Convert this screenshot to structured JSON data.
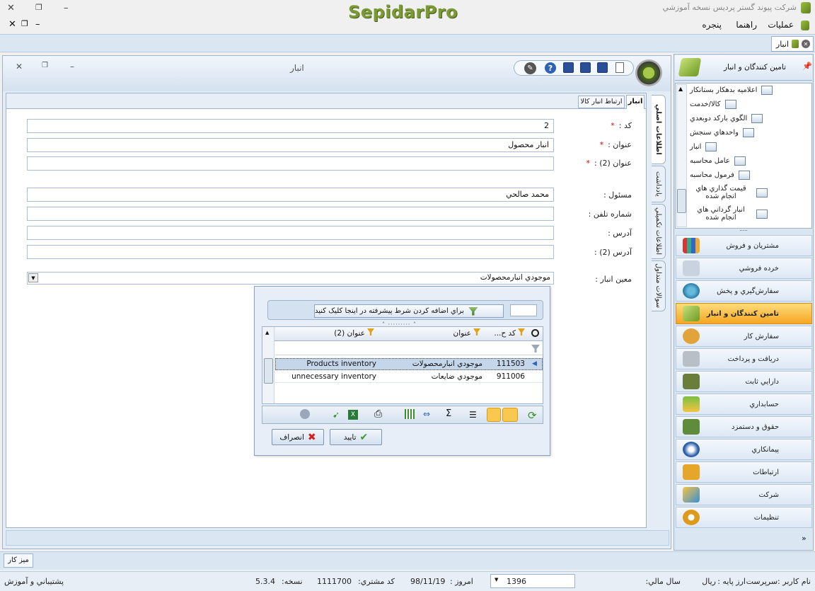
{
  "window": {
    "title": "شرکت پيوند گستر پرديس نسخه آموزشي",
    "brand": "SepidarPro"
  },
  "menubar": {
    "operations": "عمليات",
    "help": "راهنما",
    "window": "پنجره"
  },
  "doc_tab": {
    "label": "انبار"
  },
  "form": {
    "title": "انبار",
    "tabs": [
      "انبار",
      "ارتباط انبار کالا"
    ],
    "side_tabs": [
      "اطلاعات اصلي",
      "يادداشت",
      "اطلاعات تکميلي",
      "سوالات متداول"
    ],
    "fields": [
      {
        "label": "کد :",
        "value": "2",
        "required": true
      },
      {
        "label": "عنوان :",
        "value": "انبار محصول",
        "required": true
      },
      {
        "label": "عنوان (2) :",
        "value": "",
        "required": true
      },
      {
        "label": "مسئول :",
        "value": "محمد صالحي",
        "required": false
      },
      {
        "label": "شماره تلفن :",
        "value": "",
        "required": false
      },
      {
        "label": "آدرس :",
        "value": "",
        "required": false
      },
      {
        "label": "آدرس (2) :",
        "value": "",
        "required": false
      }
    ],
    "combo": {
      "label": "معين انبار :",
      "value": "موجودي  انبارمحصولات"
    }
  },
  "lookup": {
    "filter_hint": "براي اضافه کردن شرط پيشرفته در اينجا کليک کنيد",
    "columns": [
      "کد ح...",
      "عنوان",
      "عنوان (2)"
    ],
    "rows": [
      {
        "code": "111503",
        "title": "موجودي  انبارمحصولات",
        "title2": "Products inventory",
        "selected": true
      },
      {
        "code": "911006",
        "title": "موجودي ضايعات",
        "title2": "unnecessary inventory",
        "selected": false
      }
    ],
    "ok_label": "تاييد",
    "cancel_label": "انصراف"
  },
  "nav": {
    "header": "تامين کنندگان و انبار",
    "tree": [
      "اعلاميه بدهکار بستانکار",
      "کالا/خدمت",
      "الگوي بارکد دوبعدي",
      "واحدهاي سنجش",
      "انبار",
      "عامل محاسبه",
      "فرمول محاسبه",
      "قيمت گذاري هاي انجام شده",
      "انبار گرداني هاي انجام شده"
    ],
    "modules": [
      "مشتريان و فروش",
      "خرده فروشي",
      "سفارش‌گيري و پخش",
      "تامين کنندگان و انبار",
      "سفارش کار",
      "دريافت و پرداخت",
      "دارايي ثابت",
      "حسابداري",
      "حقوق و دستمزد",
      "پيمانکاري",
      "ارتباطات",
      "شرکت",
      "تنظيمات"
    ],
    "active_module": "تامين کنندگان و انبار"
  },
  "taskbar": {
    "desktop": "ميز کار"
  },
  "status": {
    "user_label": "نام کاربر :سرپرست",
    "currency_label": "ارز پايه :",
    "currency_value": "ريال",
    "fiscal_label": "سال مالي:",
    "fiscal_value": "1396",
    "today_label": "امروز :",
    "today_value": "98/11/19",
    "customer_label": "کد مشتري:",
    "customer_value": "1111700",
    "version_label": "نسخه:",
    "version_value": "5.3.4",
    "support": "پشتيباني و آموزش"
  },
  "colors": {
    "accent": "#f7b733",
    "frame": "#9db3cc",
    "brand": "#6f8f2a"
  }
}
